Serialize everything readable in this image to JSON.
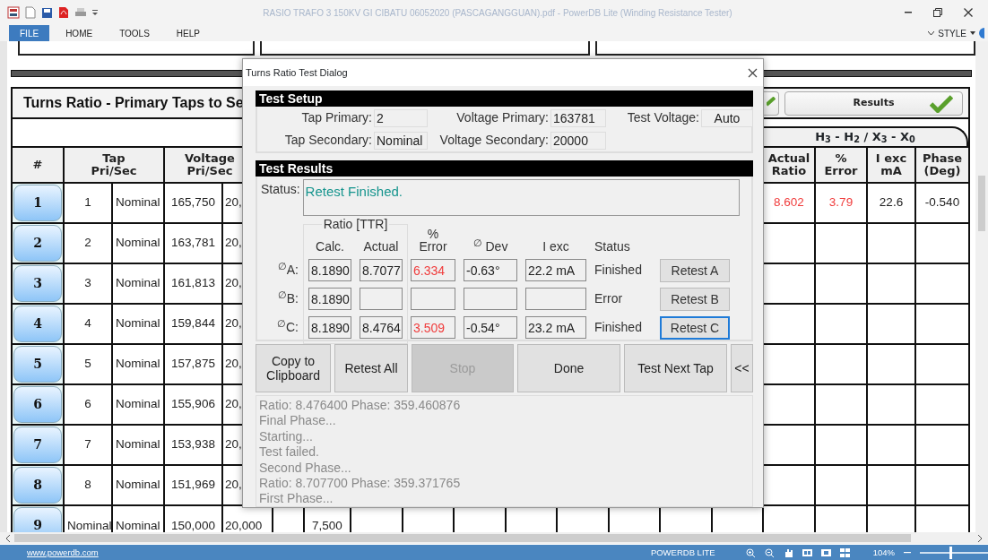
{
  "window": {
    "title": "RASIO TRAFO 3 150KV GI CIBATU 06052020 (PASCAGANGGUAN).pdf - PowerDB Lite (Winding Resistance Tester)"
  },
  "menu": [
    {
      "label": "FILE",
      "selected": true
    },
    {
      "label": "HOME",
      "selected": false
    },
    {
      "label": "TOOLS",
      "selected": false
    },
    {
      "label": "HELP",
      "selected": false
    }
  ],
  "style_menu": {
    "label": "STYLE"
  },
  "sheet": {
    "title": "Turns Ratio - Primary Taps to Se",
    "results_button": {
      "label": "Results",
      "done": true
    },
    "group_header": "H$_{3}$ - H$_{2}$ / X$_{3}$ - X$_{0}$",
    "number_header": "#",
    "tap_header": "Tap\nPri/Sec",
    "voltage_header": "Voltage\nPri/Sec",
    "result_headers": [
      "Actual\nRatio",
      "%\nError",
      "I exc\nmA",
      "Phase\n(Deg)"
    ],
    "rows": [
      {
        "number": "1",
        "tap_primary": "1",
        "tap_secondary": "Nominal",
        "voltage_primary": "165,750",
        "voltage_secondary": "20,",
        "actual_ratio": "8.602",
        "percent_error": "3.79",
        "i_exc": "22.6",
        "phase": "-0.540",
        "out_of_tolerance": true
      },
      {
        "number": "2",
        "tap_primary": "2",
        "tap_secondary": "Nominal",
        "voltage_primary": "163,781",
        "voltage_secondary": "20,"
      },
      {
        "number": "3",
        "tap_primary": "3",
        "tap_secondary": "Nominal",
        "voltage_primary": "161,813",
        "voltage_secondary": "20,"
      },
      {
        "number": "4",
        "tap_primary": "4",
        "tap_secondary": "Nominal",
        "voltage_primary": "159,844",
        "voltage_secondary": "20,"
      },
      {
        "number": "5",
        "tap_primary": "5",
        "tap_secondary": "Nominal",
        "voltage_primary": "157,875",
        "voltage_secondary": "20,"
      },
      {
        "number": "6",
        "tap_primary": "6",
        "tap_secondary": "Nominal",
        "voltage_primary": "155,906",
        "voltage_secondary": "20,"
      },
      {
        "number": "7",
        "tap_primary": "7",
        "tap_secondary": "Nominal",
        "voltage_primary": "153,938",
        "voltage_secondary": "20,"
      },
      {
        "number": "8",
        "tap_primary": "8",
        "tap_secondary": "Nominal",
        "voltage_primary": "151,969",
        "voltage_secondary": "20,"
      },
      {
        "number": "9",
        "tap_primary": "Nominal",
        "tap_secondary": "Nominal",
        "voltage_primary": "150,000",
        "voltage_secondary": "20,000",
        "column_7": "7,500"
      }
    ]
  },
  "dialog": {
    "title": "Turns Ratio Test Dialog",
    "setup_title": "Test Setup",
    "setup_fields": [
      {
        "label": "Tap Primary:",
        "value": "2"
      },
      {
        "label": "Voltage Primary:",
        "value": "163781"
      },
      {
        "label": "Test Voltage:",
        "value": "Auto"
      },
      {
        "label": "Tap Secondary:",
        "value": "Nominal"
      },
      {
        "label": "Voltage Secondary:",
        "value": "20000"
      }
    ],
    "results_title": "Test Results",
    "status_label": "Status:",
    "status": "Retest Finished.",
    "ratio_group": "Ratio [TTR]",
    "columns": [
      "Calc.",
      "Actual",
      "%\nError",
      "$^{∅}$ Dev",
      "I exc",
      "Status"
    ],
    "phases": [
      {
        "label": "$^{∅}$A:",
        "calc": "8.1890",
        "actual": "8.7077",
        "error": "6.334",
        "dev": "-0.63°",
        "i_exc": "22.2 mA",
        "status": "Finished",
        "out_of_tolerance": true,
        "retest": {
          "label": "Retest A",
          "focused": false
        }
      },
      {
        "label": "$^{∅}$B:",
        "calc": "8.1890",
        "status": "Error",
        "retest": {
          "label": "Retest B",
          "focused": false
        }
      },
      {
        "label": "$^{∅}$C:",
        "calc": "8.1890",
        "actual": "8.4764",
        "error": "3.509",
        "dev": "-0.54°",
        "i_exc": "23.2 mA",
        "status": "Finished",
        "out_of_tolerance": true,
        "retest": {
          "label": "Retest C",
          "focused": true
        }
      }
    ],
    "buttons": [
      {
        "label": "Copy to\nClipboard",
        "disabled": false
      },
      {
        "label": "Retest All",
        "disabled": false
      },
      {
        "label": "Stop",
        "disabled": true
      },
      {
        "label": "Done",
        "disabled": false
      },
      {
        "label": "Test Next Tap",
        "disabled": false
      },
      {
        "label": "<<",
        "disabled": false
      }
    ],
    "log": [
      "Ratio: 8.476400 Phase: 359.460876",
      "Final Phase...",
      "Starting...",
      "Test failed.",
      "Second Phase...",
      "Ratio: 8.707700 Phase: 359.371765",
      "First Phase..."
    ]
  },
  "status_bar": {
    "link": "www.powerdb.com",
    "product": "POWERDB LITE",
    "zoom": "104%",
    "zoom_slider": {
      "level": 0.45
    }
  }
}
